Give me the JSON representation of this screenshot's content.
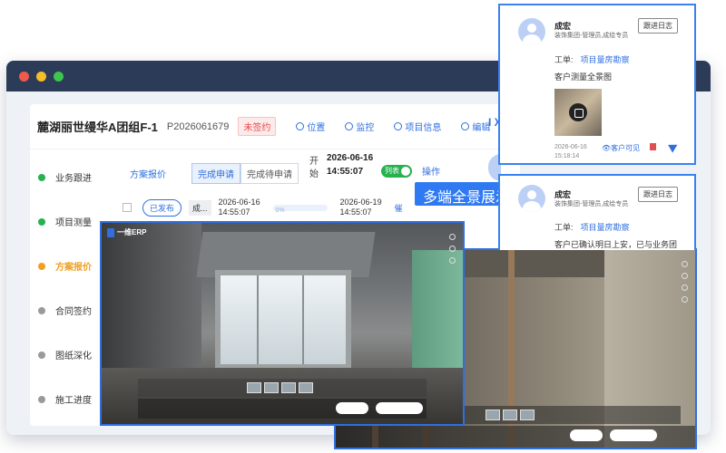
{
  "project": {
    "title": "麓湖丽世缦华A团组F-1",
    "code": "P2026061679",
    "status": "未签约",
    "links": [
      "位置",
      "监控",
      "项目信息",
      "编辑"
    ]
  },
  "sidebar": {
    "items": [
      {
        "label": "业务跟进",
        "color": "#27b14f"
      },
      {
        "label": "项目测量",
        "color": "#27b14f"
      },
      {
        "label": "方案报价",
        "color": "#f0a020"
      },
      {
        "label": "合同签约",
        "color": "#9a9a9a"
      },
      {
        "label": "图纸深化",
        "color": "#9a9a9a"
      },
      {
        "label": "施工进度",
        "color": "#9a9a9a"
      }
    ]
  },
  "tabs": {
    "main": "方案报价",
    "segment_done": "完成申请",
    "segment_pending": "完成待申请",
    "start_label": "开始",
    "start_date": "2026-06-16 14:55:07",
    "toggle_label": "列表",
    "ops": "操作"
  },
  "row": {
    "status": "已发布",
    "who": "成...",
    "date1": "2026-06-16 14:55:07",
    "progress": "0%",
    "date2": "2026-06-19 14:55:07",
    "action": "催"
  },
  "headline": "多端全景展示",
  "pano": {
    "logo": "一维ERP"
  },
  "logs": [
    {
      "user": "成宏",
      "role": "装饰集团-管理员,成绘专员",
      "button": "跟进日志",
      "order_label": "工单:",
      "order_value": "项目量房勘察",
      "note": "客户测量全景图",
      "time": "2026-06-16 15:18:14",
      "visibility": "客户可见"
    },
    {
      "user": "成宏",
      "role": "装饰集团-管理员,成绘专员",
      "button": "跟进日志",
      "order_label": "工单:",
      "order_value": "项目量房勘察",
      "note": "客户已确认明日上安，已与业务团"
    }
  ]
}
